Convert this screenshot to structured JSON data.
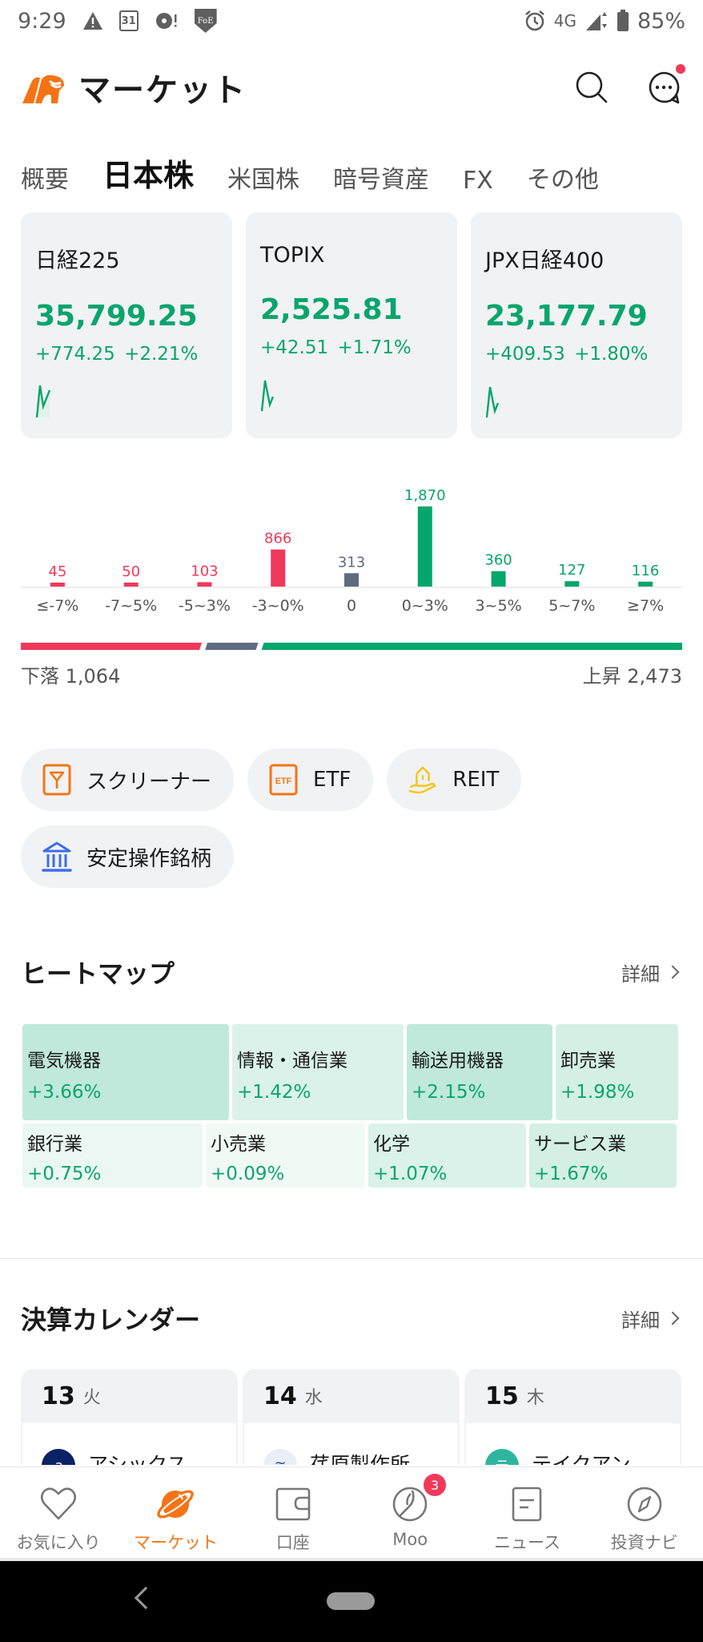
{
  "status_bar": {
    "time": "9:29",
    "calendar_day": "31",
    "shield_text": "FoE",
    "network": "4G",
    "battery": "85%"
  },
  "header": {
    "title": "マーケット"
  },
  "tabs": [
    {
      "label": "概要",
      "active": false
    },
    {
      "label": "日本株",
      "active": true
    },
    {
      "label": "米国株",
      "active": false
    },
    {
      "label": "暗号資産",
      "active": false
    },
    {
      "label": "FX",
      "active": false
    },
    {
      "label": "その他",
      "active": false
    }
  ],
  "indices": [
    {
      "name": "日経225",
      "price": "35,799.25",
      "change": "+774.25",
      "change_pct": "+2.21%"
    },
    {
      "name": "TOPIX",
      "price": "2,525.81",
      "change": "+42.51",
      "change_pct": "+1.71%"
    },
    {
      "name": "JPX日経400",
      "price": "23,177.79",
      "change": "+409.53",
      "change_pct": "+1.80%"
    }
  ],
  "chart_data": {
    "type": "bar",
    "title": "",
    "categories": [
      "≤-7%",
      "-7~5%",
      "-5~3%",
      "-3~0%",
      "0",
      "0~3%",
      "3~5%",
      "5~7%",
      "≥7%"
    ],
    "values": [
      45,
      50,
      103,
      866,
      313,
      1870,
      360,
      127,
      116
    ],
    "value_labels": [
      "45",
      "50",
      "103",
      "866",
      "313",
      "1,870",
      "360",
      "127",
      "116"
    ],
    "bar_colors": [
      "#f0395a",
      "#f0395a",
      "#f0395a",
      "#f0395a",
      "#5e6b82",
      "#05a66c",
      "#05a66c",
      "#05a66c",
      "#05a66c"
    ],
    "xlabel": "",
    "ylabel": "",
    "ylim": [
      0,
      1870
    ],
    "grid": false
  },
  "breadth": {
    "fall_label": "下落",
    "fall_count": "1,064",
    "rise_label": "上昇",
    "rise_count": "2,473",
    "fall_value": 1064,
    "flat_value": 313,
    "rise_value": 2473,
    "colors": {
      "fall": "#f0395a",
      "flat": "#5e6b82",
      "rise": "#05a66c"
    }
  },
  "quick_links": [
    {
      "label": "スクリーナー",
      "icon": "screener-icon"
    },
    {
      "label": "ETF",
      "icon": "etf-icon"
    },
    {
      "label": "REIT",
      "icon": "reit-icon"
    },
    {
      "label": "安定操作銘柄",
      "icon": "bank-icon"
    }
  ],
  "heatmap": {
    "title": "ヒートマップ",
    "more_label": "詳細",
    "rows": [
      [
        {
          "name": "電気機器",
          "change": "+3.66%"
        },
        {
          "name": "情報・通信業",
          "change": "+1.42%"
        },
        {
          "name": "輸送用機器",
          "change": "+2.15%"
        },
        {
          "name": "卸売業",
          "change": "+1.98%"
        }
      ],
      [
        {
          "name": "銀行業",
          "change": "+0.75%"
        },
        {
          "name": "小売業",
          "change": "+0.09%"
        },
        {
          "name": "化学",
          "change": "+1.07%"
        },
        {
          "name": "サービス業",
          "change": "+1.67%"
        }
      ]
    ]
  },
  "earnings_calendar": {
    "title": "決算カレンダー",
    "more_label": "詳細",
    "days": [
      {
        "day": "13",
        "weekday": "火",
        "company": "アシックス",
        "logo_text": "a",
        "logo_color": "#0b2264"
      },
      {
        "day": "14",
        "weekday": "水",
        "company": "荏原製作所",
        "logo_text": "≋",
        "logo_color": "#e9eef7"
      },
      {
        "day": "15",
        "weekday": "木",
        "company": "テイクアン…",
        "logo_text": "テ",
        "logo_color": "#2eb5a0"
      }
    ]
  },
  "bottom_nav": [
    {
      "label": "お気に入り",
      "icon": "heart-icon",
      "active": false
    },
    {
      "label": "マーケット",
      "icon": "planet-icon",
      "active": true
    },
    {
      "label": "口座",
      "icon": "wallet-icon",
      "active": false
    },
    {
      "label": "Moo",
      "icon": "moo-icon",
      "active": false,
      "badge": "3"
    },
    {
      "label": "ニュース",
      "icon": "news-icon",
      "active": false
    },
    {
      "label": "投資ナビ",
      "icon": "compass-icon",
      "active": false
    }
  ]
}
